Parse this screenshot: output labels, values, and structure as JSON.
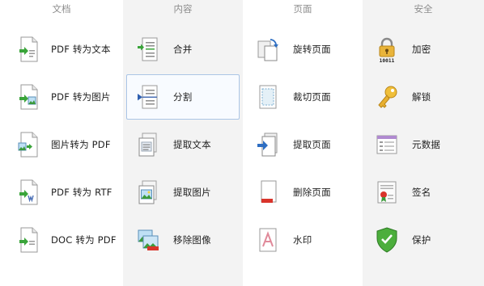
{
  "columns": [
    {
      "header": "文档",
      "items": [
        {
          "label": "PDF 转为文本"
        },
        {
          "label": "PDF 转为图片"
        },
        {
          "label": "图片转为 PDF"
        },
        {
          "label": "PDF 转为 RTF"
        },
        {
          "label": "DOC 转为 PDF"
        }
      ]
    },
    {
      "header": "内容",
      "items": [
        {
          "label": "合并"
        },
        {
          "label": "分割",
          "selected": true
        },
        {
          "label": "提取文本"
        },
        {
          "label": "提取图片"
        },
        {
          "label": "移除图像"
        }
      ]
    },
    {
      "header": "页面",
      "items": [
        {
          "label": "旋转页面"
        },
        {
          "label": "裁切页面"
        },
        {
          "label": "提取页面"
        },
        {
          "label": "删除页面"
        },
        {
          "label": "水印"
        }
      ]
    },
    {
      "header": "安全",
      "items": [
        {
          "label": "加密"
        },
        {
          "label": "解锁"
        },
        {
          "label": "元数据"
        },
        {
          "label": "签名"
        },
        {
          "label": "保护"
        }
      ]
    }
  ],
  "icons": {
    "encrypt_digits": "10011"
  },
  "colors": {
    "selection_border": "#a7c3e6",
    "selection_fill": "#f8fbff",
    "shaded_column": "#f3f3f3",
    "header_text": "#8d8d8d"
  }
}
